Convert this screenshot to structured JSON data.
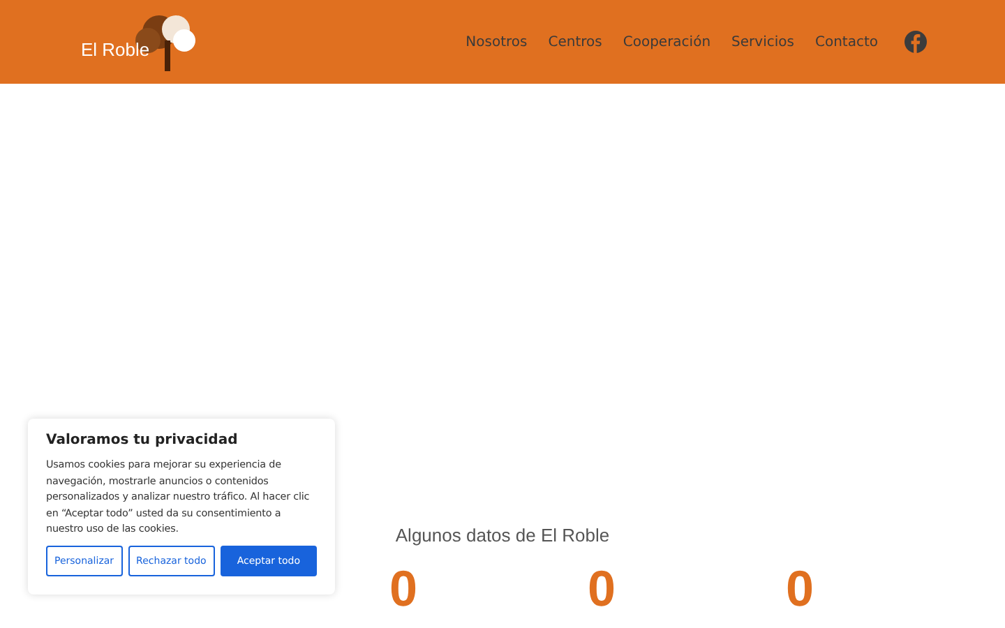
{
  "header": {
    "logo_text": "El Roble",
    "nav": [
      {
        "label": "Nosotros"
      },
      {
        "label": "Centros"
      },
      {
        "label": "Cooperación"
      },
      {
        "label": "Servicios"
      },
      {
        "label": "Contacto"
      }
    ]
  },
  "stats": {
    "title": "Algunos datos de El Roble",
    "items": [
      {
        "value": "0"
      },
      {
        "value": "0"
      },
      {
        "value": "0"
      }
    ]
  },
  "cookie_banner": {
    "title": "Valoramos tu privacidad",
    "text": "Usamos cookies para mejorar su experiencia de navegación, mostrarle anuncios o contenidos personalizados y analizar nuestro tráfico. Al hacer clic en “Aceptar todo” usted da su consentimiento a nuestro uso de las cookies.",
    "buttons": [
      {
        "label": "Personalizar",
        "kind": "outline"
      },
      {
        "label": "Rechazar todo",
        "kind": "outline"
      },
      {
        "label": "Aceptar todo",
        "kind": "primary"
      }
    ]
  }
}
